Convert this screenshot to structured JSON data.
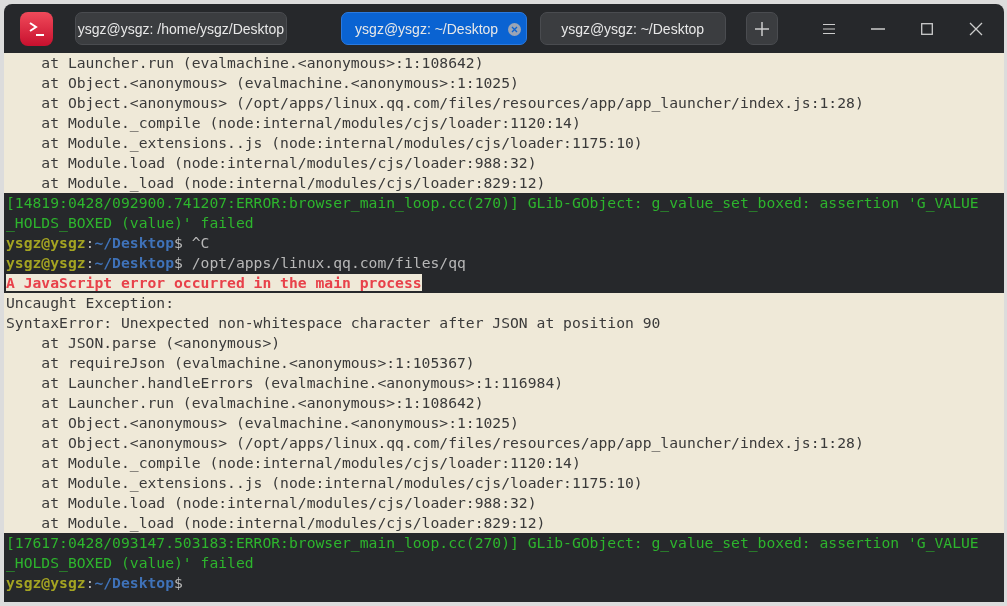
{
  "window": {
    "tabs": [
      {
        "label": "ysgz@ysgz: /home/ysgz/Desktop",
        "selected": false
      },
      {
        "label": "ysgz@ysgz: ~/Desktop",
        "selected": true
      },
      {
        "label": "ysgz@ysgz: ~/Desktop",
        "selected": false
      }
    ]
  },
  "terminal": {
    "lines": [
      {
        "kind": "stack",
        "text": "    at Launcher.run (evalmachine.<anonymous>:1:108642)"
      },
      {
        "kind": "stack",
        "text": "    at Object.<anonymous> (evalmachine.<anonymous>:1:1025)"
      },
      {
        "kind": "stack",
        "text": "    at Object.<anonymous> (/opt/apps/linux.qq.com/files/resources/app/app_launcher/index.js:1:28)"
      },
      {
        "kind": "stack",
        "text": "    at Module._compile (node:internal/modules/cjs/loader:1120:14)"
      },
      {
        "kind": "stack",
        "text": "    at Module._extensions..js (node:internal/modules/cjs/loader:1175:10)"
      },
      {
        "kind": "stack",
        "text": "    at Module.load (node:internal/modules/cjs/loader:988:32)"
      },
      {
        "kind": "stack",
        "text": "    at Module._load (node:internal/modules/cjs/loader:829:12)"
      },
      {
        "kind": "log",
        "text": "[14819:0428/092900.741207:ERROR:browser_main_loop.cc(270)] GLib-GObject: g_value_set_boxed: assertion 'G_VALUE"
      },
      {
        "kind": "log",
        "text": "_HOLDS_BOXED (value)' failed"
      },
      {
        "kind": "prompt",
        "user": "ysgz@ysgz",
        "separator": ":",
        "path": "~/Desktop",
        "symbol": "$",
        "text": "^C"
      },
      {
        "kind": "prompt",
        "user": "ysgz@ysgz",
        "separator": ":",
        "path": "~/Desktop",
        "symbol": "$",
        "text": "/opt/apps/linux.qq.com/files/qq"
      },
      {
        "kind": "alert",
        "text": "A JavaScript error occurred in the main process"
      },
      {
        "kind": "stack",
        "text": "Uncaught Exception:"
      },
      {
        "kind": "stack",
        "text": "SyntaxError: Unexpected non-whitespace character after JSON at position 90"
      },
      {
        "kind": "stack",
        "text": "    at JSON.parse (<anonymous>)"
      },
      {
        "kind": "stack",
        "text": "    at requireJson (evalmachine.<anonymous>:1:105367)"
      },
      {
        "kind": "stack",
        "text": "    at Launcher.handleErrors (evalmachine.<anonymous>:1:116984)"
      },
      {
        "kind": "stack",
        "text": "    at Launcher.run (evalmachine.<anonymous>:1:108642)"
      },
      {
        "kind": "stack",
        "text": "    at Object.<anonymous> (evalmachine.<anonymous>:1:1025)"
      },
      {
        "kind": "stack",
        "text": "    at Object.<anonymous> (/opt/apps/linux.qq.com/files/resources/app/app_launcher/index.js:1:28)"
      },
      {
        "kind": "stack",
        "text": "    at Module._compile (node:internal/modules/cjs/loader:1120:14)"
      },
      {
        "kind": "stack",
        "text": "    at Module._extensions..js (node:internal/modules/cjs/loader:1175:10)"
      },
      {
        "kind": "stack",
        "text": "    at Module.load (node:internal/modules/cjs/loader:988:32)"
      },
      {
        "kind": "stack",
        "text": "    at Module._load (node:internal/modules/cjs/loader:829:12)"
      },
      {
        "kind": "log",
        "text": "[17617:0428/093147.503183:ERROR:browser_main_loop.cc(270)] GLib-GObject: g_value_set_boxed: assertion 'G_VALUE"
      },
      {
        "kind": "log",
        "text": "_HOLDS_BOXED (value)' failed"
      },
      {
        "kind": "prompt",
        "user": "ysgz@ysgz",
        "separator": ":",
        "path": "~/Desktop",
        "symbol": "$"
      }
    ]
  }
}
